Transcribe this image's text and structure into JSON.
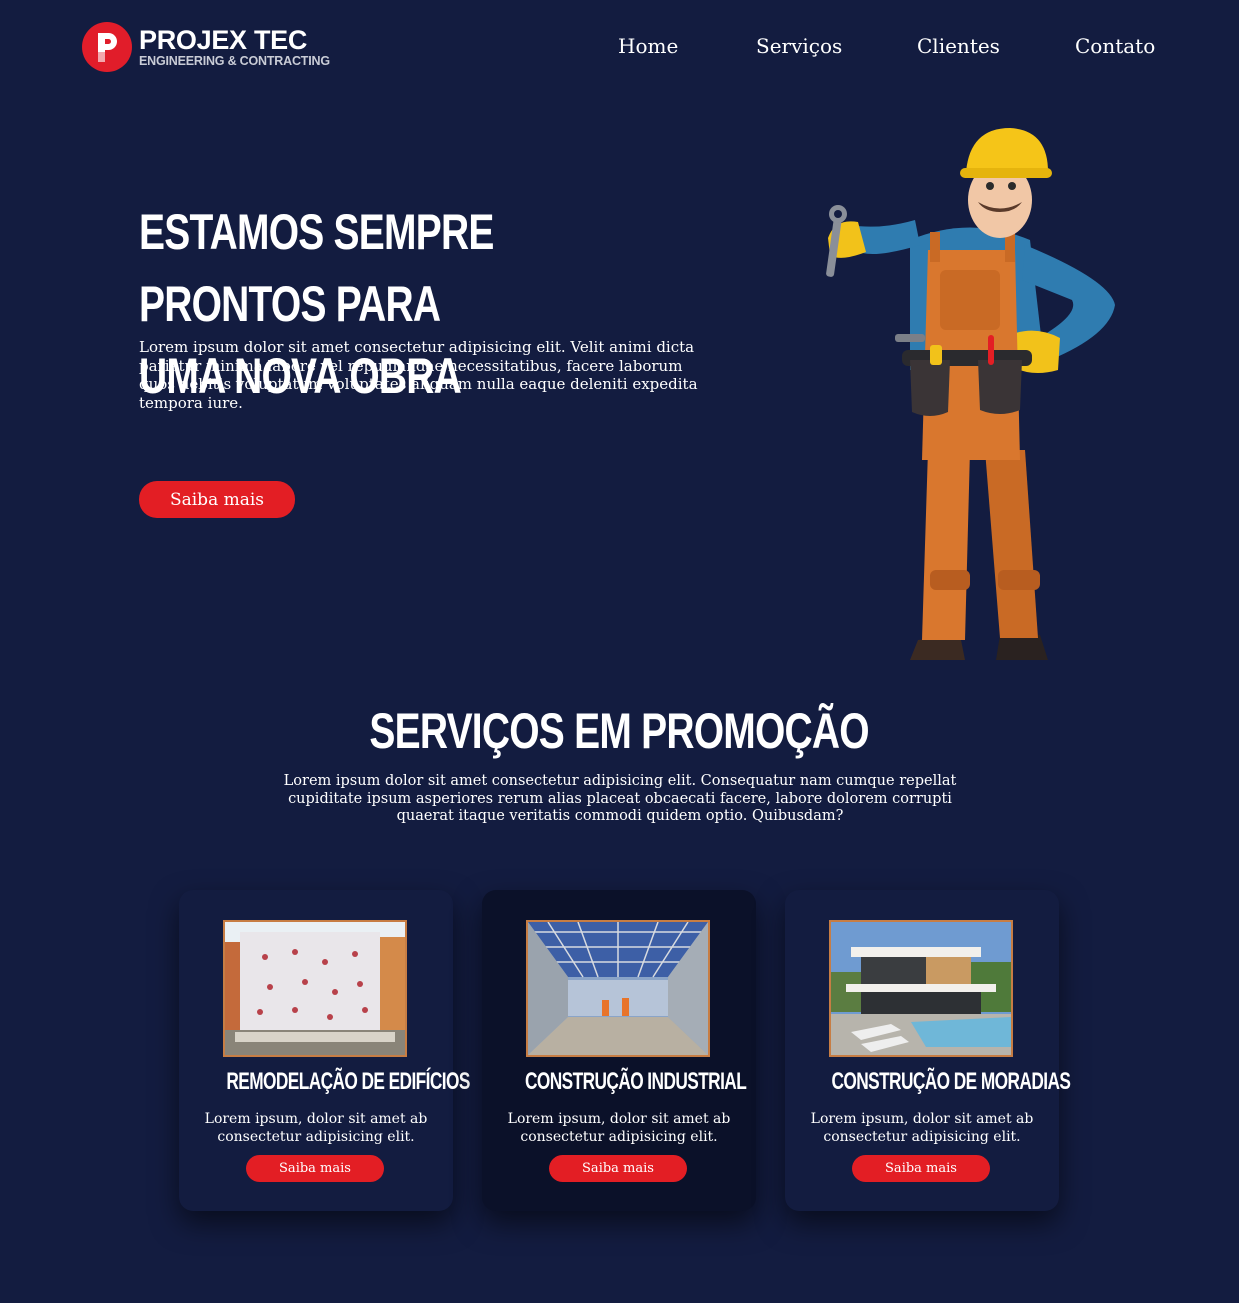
{
  "brand": {
    "name": "PROJEX TEC",
    "tagline": "ENGINEERING & CONTRACTING",
    "accent_color": "#e31e24",
    "background_color": "#131c40"
  },
  "nav": {
    "items": [
      "Home",
      "Serviços",
      "Clientes",
      "Contato"
    ]
  },
  "hero": {
    "title": "ESTAMOS SEMPRE PRONTOS PARA\nUMA NOVA OBRA",
    "text": "Lorem ipsum dolor sit amet consectetur adipisicing elit. Velit animi dicta pariatur minima labore vel repudiandae necessitatibus, facere laborum quos debitis voluptatum voluptates aliquam nulla eaque deleniti expedita tempora iure.",
    "button_label": "Saiba mais",
    "image": "construction-worker-3d-illustration"
  },
  "services": {
    "title": "SERVIÇOS EM PROMOÇÃO",
    "text": "Lorem ipsum dolor sit amet consectetur adipisicing elit. Consequatur nam cumque repellat cupiditate ipsum asperiores rerum alias placeat obcaecati facere, labore dolorem corrupti quaerat itaque veritatis commodi quidem optio. Quibusdam?",
    "cards": [
      {
        "title": "REMODELAÇÃO DE EDIFÍCIOS",
        "text": "Lorem ipsum, dolor sit amet ab consectetur adipisicing elit.",
        "button_label": "Saiba mais",
        "image": "building-facade-renovation"
      },
      {
        "title": "CONSTRUÇÃO INDUSTRIAL",
        "text": "Lorem ipsum, dolor sit amet ab consectetur adipisicing elit.",
        "button_label": "Saiba mais",
        "image": "steel-industrial-hall"
      },
      {
        "title": "CONSTRUÇÃO DE MORADIAS",
        "text": "Lorem ipsum, dolor sit amet ab consectetur adipisicing elit.",
        "button_label": "Saiba mais",
        "image": "modern-house-with-pool"
      }
    ]
  }
}
